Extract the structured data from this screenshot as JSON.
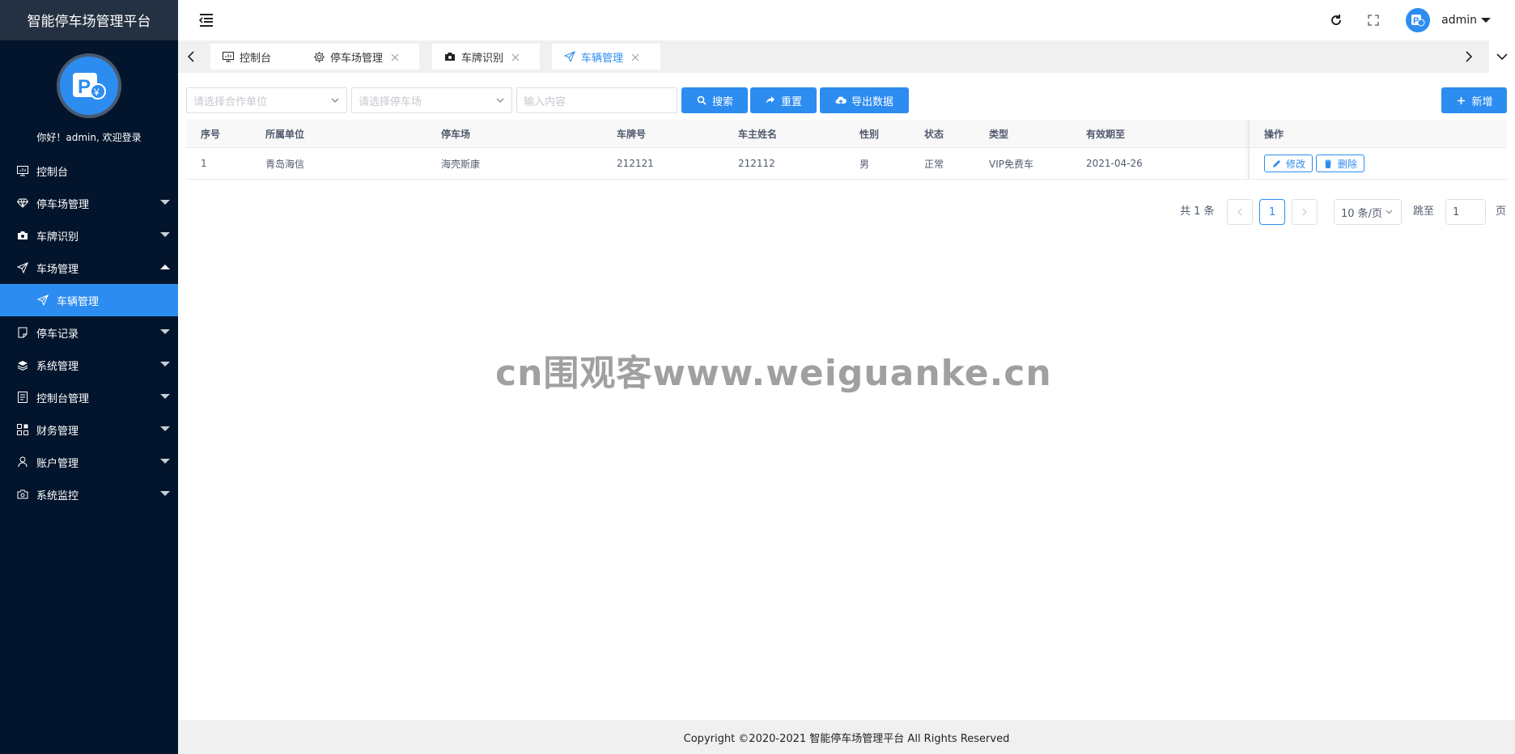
{
  "app": {
    "title": "智能停车场管理平台"
  },
  "sidebar": {
    "welcome": "你好！admin, 欢迎登录",
    "items": [
      {
        "label": "控制台",
        "icon": "monitor-icon",
        "has_arrow": false
      },
      {
        "label": "停车场管理",
        "icon": "diamond-icon",
        "has_arrow": true
      },
      {
        "label": "车牌识别",
        "icon": "camera-icon",
        "has_arrow": true
      },
      {
        "label": "车场管理",
        "icon": "paper-plane-icon",
        "has_arrow": true,
        "expanded": true
      },
      {
        "label": "车辆管理",
        "icon": "paper-plane-icon",
        "active": true
      },
      {
        "label": "停车记录",
        "icon": "document-icon",
        "has_arrow": true
      },
      {
        "label": "系统管理",
        "icon": "layers-icon",
        "has_arrow": true
      },
      {
        "label": "控制台管理",
        "icon": "list-doc-icon",
        "has_arrow": true
      },
      {
        "label": "财务管理",
        "icon": "grid-icon",
        "has_arrow": true
      },
      {
        "label": "账户管理",
        "icon": "user-icon",
        "has_arrow": true
      },
      {
        "label": "系统监控",
        "icon": "camera-outline-icon",
        "has_arrow": true
      }
    ]
  },
  "header": {
    "user": "admin"
  },
  "tabs": [
    {
      "label": "控制台",
      "icon": "monitor-icon",
      "closable": false
    },
    {
      "label": "停车场管理",
      "icon": "gear-icon",
      "closable": true
    },
    {
      "label": "车牌识别",
      "icon": "camera-icon",
      "closable": true
    },
    {
      "label": "车辆管理",
      "icon": "paper-plane-icon",
      "closable": true,
      "active": true
    }
  ],
  "toolbar": {
    "partner_placeholder": "请选择合作单位",
    "lot_placeholder": "请选择停车场",
    "keyword_placeholder": "输入内容",
    "search_label": "搜索",
    "reset_label": "重置",
    "export_label": "导出数据",
    "add_label": "新增"
  },
  "table": {
    "columns": [
      "序号",
      "所属单位",
      "停车场",
      "车牌号",
      "车主姓名",
      "性别",
      "状态",
      "类型",
      "有效期至",
      "操作"
    ],
    "rows": [
      [
        "1",
        "青岛海信",
        "海壳斯康",
        "212121",
        "212112",
        "男",
        "正常",
        "VIP免费车",
        "2021-04-26"
      ]
    ],
    "edit_label": "修改",
    "delete_label": "删除"
  },
  "pagination": {
    "total_text": "共 1 条",
    "current_page": "1",
    "page_size": "10 条/页",
    "jump_label": "跳至",
    "jump_value": "1",
    "page_suffix": "页"
  },
  "watermark": "cn围观客www.weiguanke.cn",
  "footer": {
    "copyright": "Copyright ©2020-2021 智能停车场管理平台 All Rights Reserved"
  },
  "colors": {
    "primary": "#2d8cf0",
    "sidebar_bg": "#03152c",
    "brand_bg": "#243142"
  }
}
